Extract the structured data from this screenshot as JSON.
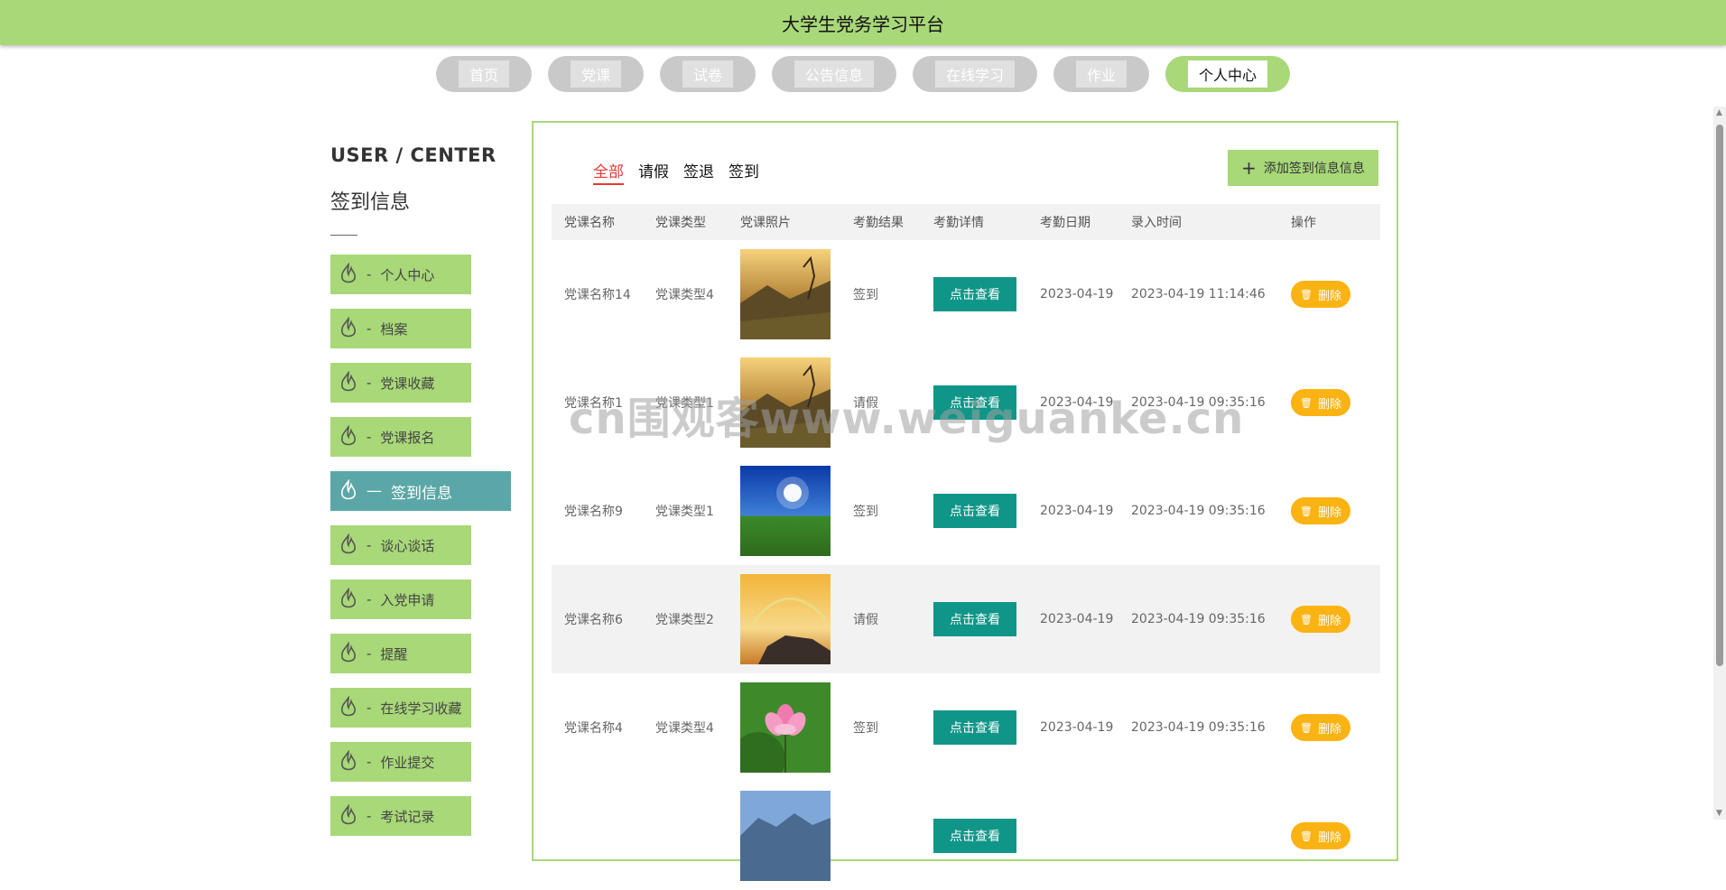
{
  "header": {
    "title": "大学生党务学习平台"
  },
  "nav": [
    {
      "label": "首页",
      "active": false
    },
    {
      "label": "党课",
      "active": false
    },
    {
      "label": "试卷",
      "active": false
    },
    {
      "label": "公告信息",
      "active": false
    },
    {
      "label": "在线学习",
      "active": false
    },
    {
      "label": "作业",
      "active": false
    },
    {
      "label": "个人中心",
      "active": true
    }
  ],
  "sidebar": {
    "title": "USER / CENTER",
    "subtitle": "签到信息",
    "items": [
      {
        "label": "个人中心",
        "active": false
      },
      {
        "label": "档案",
        "active": false
      },
      {
        "label": "党课收藏",
        "active": false
      },
      {
        "label": "党课报名",
        "active": false
      },
      {
        "label": "签到信息",
        "active": true
      },
      {
        "label": "谈心谈话",
        "active": false
      },
      {
        "label": "入党申请",
        "active": false
      },
      {
        "label": "提醒",
        "active": false
      },
      {
        "label": "在线学习收藏",
        "active": false
      },
      {
        "label": "作业提交",
        "active": false
      },
      {
        "label": "考试记录",
        "active": false
      }
    ]
  },
  "filters": [
    "全部",
    "请假",
    "签退",
    "签到"
  ],
  "add_button": {
    "label": "添加签到信息信息"
  },
  "table": {
    "columns": [
      "党课名称",
      "党课类型",
      "党课照片",
      "考勤结果",
      "考勤详情",
      "考勤日期",
      "录入时间",
      "操作"
    ],
    "view_label": "点击查看",
    "delete_label": "删除",
    "rows": [
      {
        "name": "党课名称14",
        "type": "党课类型4",
        "photo": "mountain-sunset",
        "result": "签到",
        "date": "2023-04-19",
        "time": "2023-04-19 11:14:46"
      },
      {
        "name": "党课名称1",
        "type": "党课类型1",
        "photo": "mountain-sunset",
        "result": "请假",
        "date": "2023-04-19",
        "time": "2023-04-19 09:35:16"
      },
      {
        "name": "党课名称9",
        "type": "党课类型1",
        "photo": "blue-sky-grass",
        "result": "签到",
        "date": "2023-04-19",
        "time": "2023-04-19 09:35:16"
      },
      {
        "name": "党课名称6",
        "type": "党课类型2",
        "photo": "sunset-rainbow",
        "result": "请假",
        "date": "2023-04-19",
        "time": "2023-04-19 09:35:16"
      },
      {
        "name": "党课名称4",
        "type": "党课类型4",
        "photo": "lotus-flower",
        "result": "签到",
        "date": "2023-04-19",
        "time": "2023-04-19 09:35:16"
      },
      {
        "name": "",
        "type": "",
        "photo": "blue-mountain",
        "result": "",
        "date": "",
        "time": ""
      }
    ]
  },
  "watermark": "cn围观客www.weiguanke.cn",
  "colors": {
    "accent": "#a8d878",
    "active_side": "#5ba7a7",
    "view": "#0f9688",
    "delete": "#fbb313",
    "filter_active": "#e53935"
  }
}
